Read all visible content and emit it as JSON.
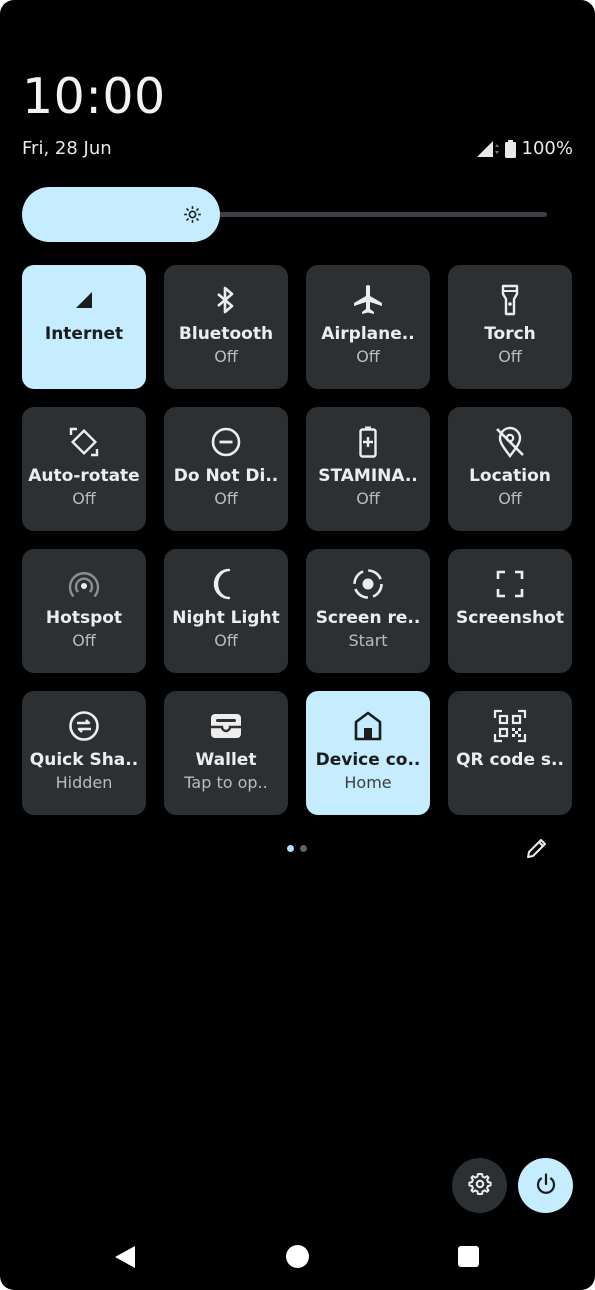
{
  "status_bar": {
    "time": "10:00",
    "date": "Fri, 28 Jun",
    "battery": "100%"
  },
  "brightness": {
    "level": 0.32,
    "icon": "brightness-icon"
  },
  "tiles": [
    {
      "label": "Internet",
      "sub": "",
      "icon": "signal-icon",
      "active": true
    },
    {
      "label": "Bluetooth",
      "sub": "Off",
      "icon": "bluetooth-icon",
      "active": false
    },
    {
      "label": "Airplane..",
      "sub": "Off",
      "icon": "airplane-icon",
      "active": false
    },
    {
      "label": "Torch",
      "sub": "Off",
      "icon": "torch-icon",
      "active": false
    },
    {
      "label": "Auto-rotate",
      "sub": "Off",
      "icon": "auto-rotate-icon",
      "active": false
    },
    {
      "label": "Do Not Di..",
      "sub": "Off",
      "icon": "do-not-disturb-icon",
      "active": false
    },
    {
      "label": "STAMINA..",
      "sub": "Off",
      "icon": "battery-saver-icon",
      "active": false
    },
    {
      "label": "Location",
      "sub": "Off",
      "icon": "location-off-icon",
      "active": false
    },
    {
      "label": "Hotspot",
      "sub": "Off",
      "icon": "hotspot-icon",
      "active": false
    },
    {
      "label": "Night Light",
      "sub": "Off",
      "icon": "moon-icon",
      "active": false
    },
    {
      "label": "Screen re..",
      "sub": "Start",
      "icon": "screen-record-icon",
      "active": false
    },
    {
      "label": "Screenshot",
      "sub": "",
      "icon": "screenshot-icon",
      "active": false
    },
    {
      "label": "Quick Sha..",
      "sub": "Hidden",
      "icon": "quick-share-icon",
      "active": false
    },
    {
      "label": "Wallet",
      "sub": "Tap to op..",
      "icon": "wallet-icon",
      "active": false
    },
    {
      "label": "Device co..",
      "sub": "Home",
      "icon": "home-icon",
      "active": true
    },
    {
      "label": "QR code s..",
      "sub": "",
      "icon": "qr-code-icon",
      "active": false
    }
  ],
  "pager": {
    "pages": 2,
    "current": 1
  },
  "colors": {
    "background": "#000000",
    "tile": "#2d3033",
    "tile_active": "#c5ecff",
    "accent": "#aee3ff"
  }
}
